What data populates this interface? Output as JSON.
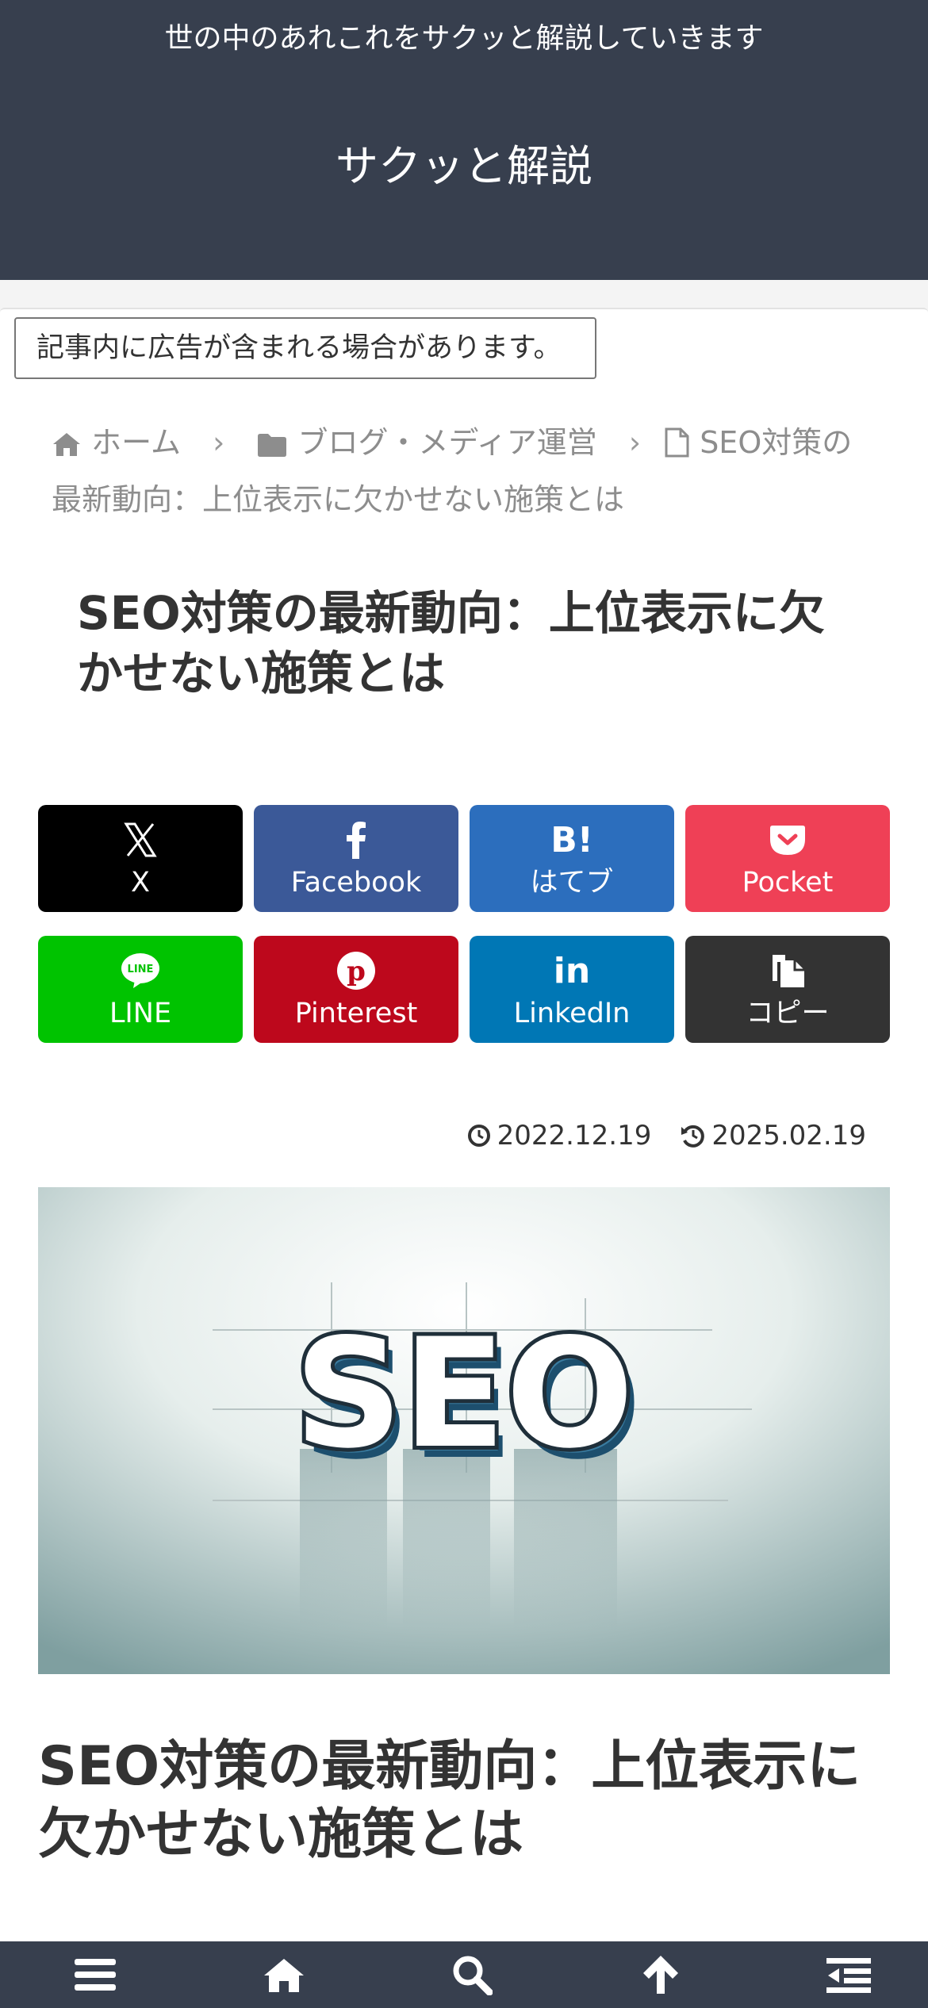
{
  "header": {
    "tagline": "世の中のあれこれをサクッと解説していきます",
    "site_title": "サクッと解説"
  },
  "ad_notice": "記事内に広告が含まれる場合があります。",
  "breadcrumb": {
    "home": "ホーム",
    "category": "ブログ・メディア運営",
    "current": "SEO対策の最新動向：上位表示に欠かせない施策とは"
  },
  "article": {
    "title": "SEO対策の最新動向：上位表示に欠かせない施策とは",
    "published": "2022.12.19",
    "updated": "2025.02.19",
    "eyecatch_text": "SEO"
  },
  "share": [
    {
      "label": "X",
      "icon": "x-icon",
      "color": "#000000"
    },
    {
      "label": "Facebook",
      "icon": "facebook-icon",
      "color": "#3b5998"
    },
    {
      "label": "はてブ",
      "icon": "hatena-bookmark-icon",
      "color": "#2c6ebd"
    },
    {
      "label": "Pocket",
      "icon": "pocket-icon",
      "color": "#ef4056"
    },
    {
      "label": "LINE",
      "icon": "line-icon",
      "color": "#00c300"
    },
    {
      "label": "Pinterest",
      "icon": "pinterest-icon",
      "color": "#bd081c"
    },
    {
      "label": "LinkedIn",
      "icon": "linkedin-icon",
      "color": "#0077b5"
    },
    {
      "label": "コピー",
      "icon": "copy-icon",
      "color": "#333333"
    }
  ],
  "footer_nav": [
    {
      "icon": "menu-icon"
    },
    {
      "icon": "home-icon"
    },
    {
      "icon": "search-icon"
    },
    {
      "icon": "arrow-up-icon"
    },
    {
      "icon": "sidebar-icon"
    }
  ],
  "colors": {
    "header_bg": "#373f4e",
    "text": "#333333",
    "breadcrumb": "#8d8d8d"
  }
}
